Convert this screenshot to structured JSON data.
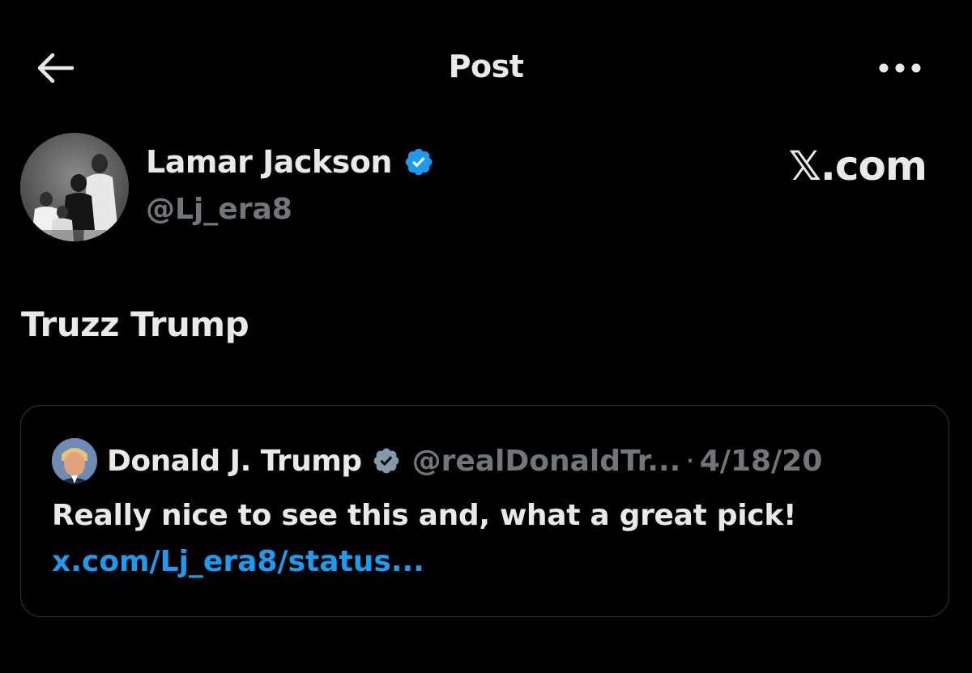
{
  "header": {
    "title": "Post",
    "back_icon": "arrow-left-icon",
    "more_icon": "more-horizontal-icon"
  },
  "author": {
    "name": "Lamar Jackson",
    "handle": "@Lj_era8",
    "verified_icon": "verified-badge-icon",
    "verified_color": "#1d9bf0"
  },
  "brand": "𝕏.com",
  "post": {
    "text": "Truzz Trump"
  },
  "quote": {
    "name": "Donald J. Trump",
    "handle": "@realDonaldTr...",
    "separator": "·",
    "date": "4/18/20",
    "verified_icon": "verified-badge-gray-icon",
    "verified_color": "#829aab",
    "text": "Really nice to see this and, what a great pick!",
    "link": "x.com/Lj_era8/status..."
  },
  "colors": {
    "background": "#000000",
    "primary_text": "#e7e9ea",
    "secondary_text": "#71767b",
    "link": "#1d9bf0",
    "border": "#333639"
  }
}
